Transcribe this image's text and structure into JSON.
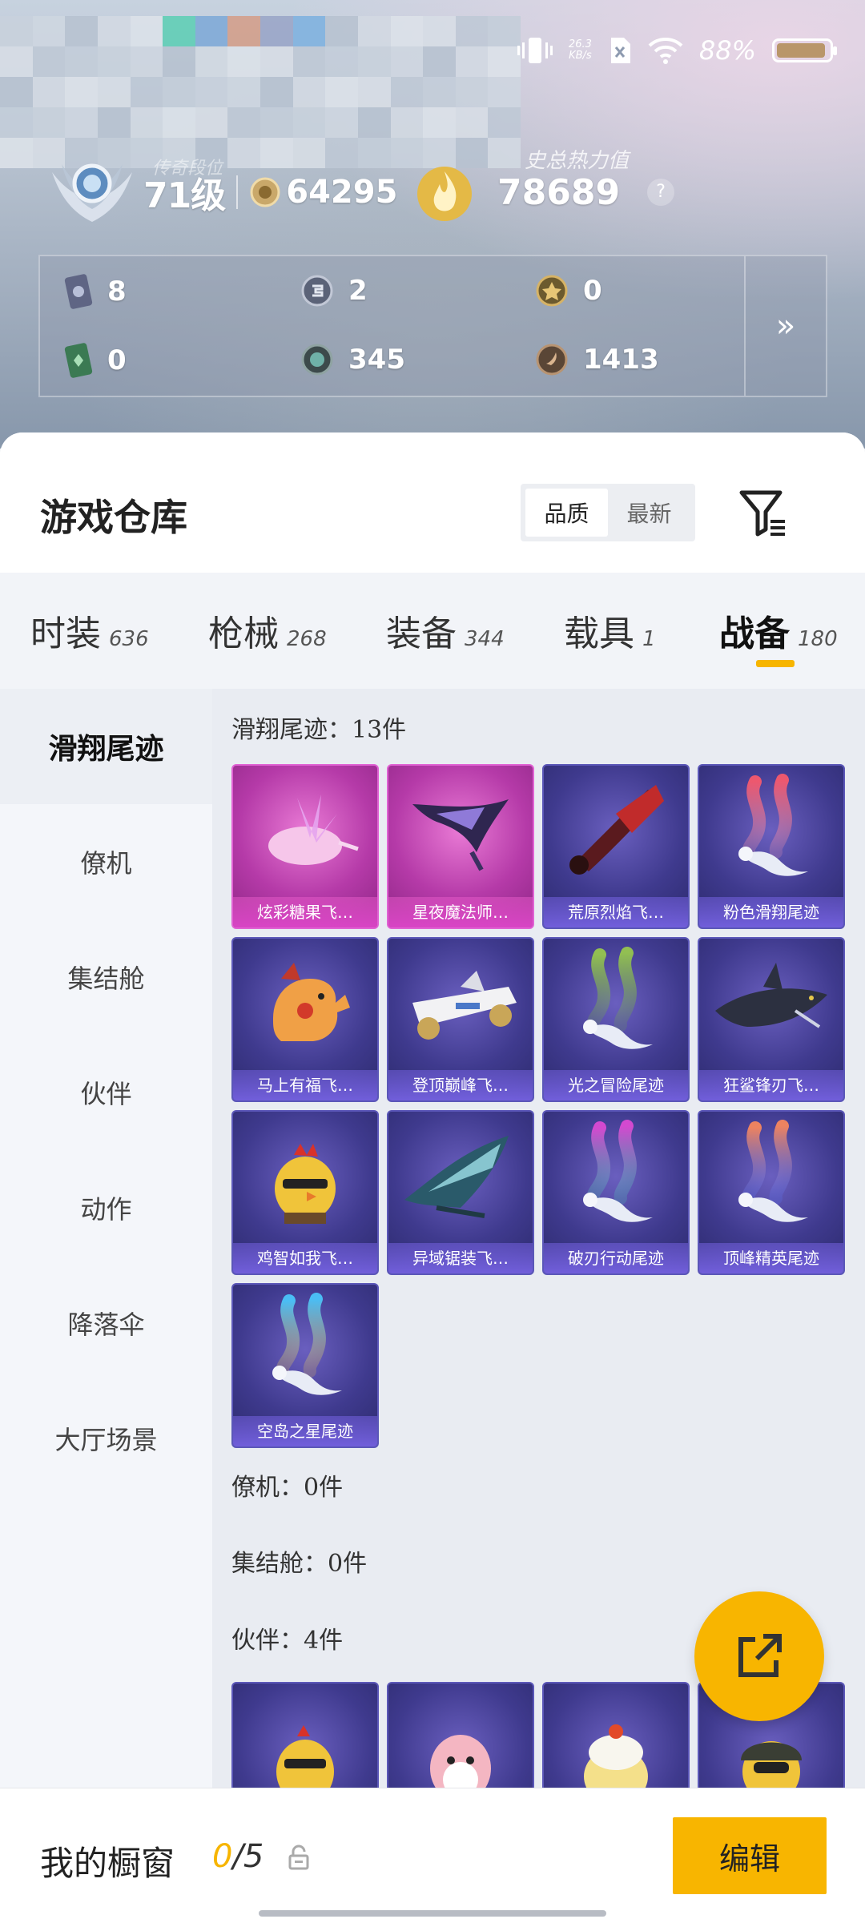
{
  "status_bar": {
    "net_speed": "26.3",
    "net_unit": "KB/s",
    "battery_pct": "88%"
  },
  "profile": {
    "faded_label": "传奇段位",
    "level": "71级",
    "coins": "64295",
    "heat_label": "史总热力值",
    "heat_value": "78689",
    "help": "?"
  },
  "resources": [
    {
      "icon": "card-icon",
      "value": "8"
    },
    {
      "icon": "silver-coin-icon",
      "value": "2"
    },
    {
      "icon": "gold-coin-icon",
      "value": "0"
    },
    {
      "icon": "green-card-icon",
      "value": "0"
    },
    {
      "icon": "teal-orb-icon",
      "value": "345"
    },
    {
      "icon": "bronze-coin-icon",
      "value": "1413"
    }
  ],
  "resources_more": "»",
  "warehouse": {
    "title": "游戏仓库",
    "sort_options": [
      "品质",
      "最新"
    ],
    "active_sort": "品质"
  },
  "categories": [
    {
      "name": "时装",
      "count": "636"
    },
    {
      "name": "枪械",
      "count": "268"
    },
    {
      "name": "装备",
      "count": "344"
    },
    {
      "name": "载具",
      "count": "1"
    },
    {
      "name": "战备",
      "count": "180"
    }
  ],
  "active_category": "战备",
  "side_nav": [
    "滑翔尾迹",
    "僚机",
    "集结舱",
    "伙伴",
    "动作",
    "降落伞",
    "大厅场景"
  ],
  "active_side": "滑翔尾迹",
  "sections": {
    "glide_title": "滑翔尾迹：13件",
    "wingman_title": "僚机：0件",
    "pod_title": "集结舱：0件",
    "partner_title": "伙伴：4件"
  },
  "glide_items": [
    {
      "label": "炫彩糖果飞…",
      "rarity": "pink",
      "art": "candy"
    },
    {
      "label": "星夜魔法师…",
      "rarity": "pink",
      "art": "wing"
    },
    {
      "label": "荒原烈焰飞…",
      "rarity": "purple",
      "art": "mech"
    },
    {
      "label": "粉色滑翔尾迹",
      "rarity": "purple",
      "art": "smoke-pink"
    },
    {
      "label": "马上有福飞…",
      "rarity": "purple",
      "art": "horse"
    },
    {
      "label": "登顶巅峰飞…",
      "rarity": "purple",
      "art": "plane"
    },
    {
      "label": "光之冒险尾迹",
      "rarity": "purple",
      "art": "smoke-green"
    },
    {
      "label": "狂鲨锋刃飞…",
      "rarity": "purple",
      "art": "shark"
    },
    {
      "label": "鸡智如我飞…",
      "rarity": "purple",
      "art": "chicken"
    },
    {
      "label": "异域锯装飞…",
      "rarity": "purple",
      "art": "glider"
    },
    {
      "label": "破刃行动尾迹",
      "rarity": "purple",
      "art": "smoke-rainbow"
    },
    {
      "label": "顶峰精英尾迹",
      "rarity": "purple",
      "art": "smoke-blue"
    },
    {
      "label": "空岛之星尾迹",
      "rarity": "purple",
      "art": "smoke-rainbow2"
    }
  ],
  "partner_items": [
    {
      "art": "chicken2"
    },
    {
      "art": "pink-bird"
    },
    {
      "art": "yellow-chick"
    },
    {
      "art": "helmet-chick"
    }
  ],
  "showcase": {
    "title": "我的橱窗",
    "count_current": "0",
    "count_total": "/5",
    "edit_label": "编辑"
  },
  "colors": {
    "accent": "#f8b500",
    "pink_rarity": "#c13cb3",
    "purple_rarity": "#3f3a8e"
  }
}
